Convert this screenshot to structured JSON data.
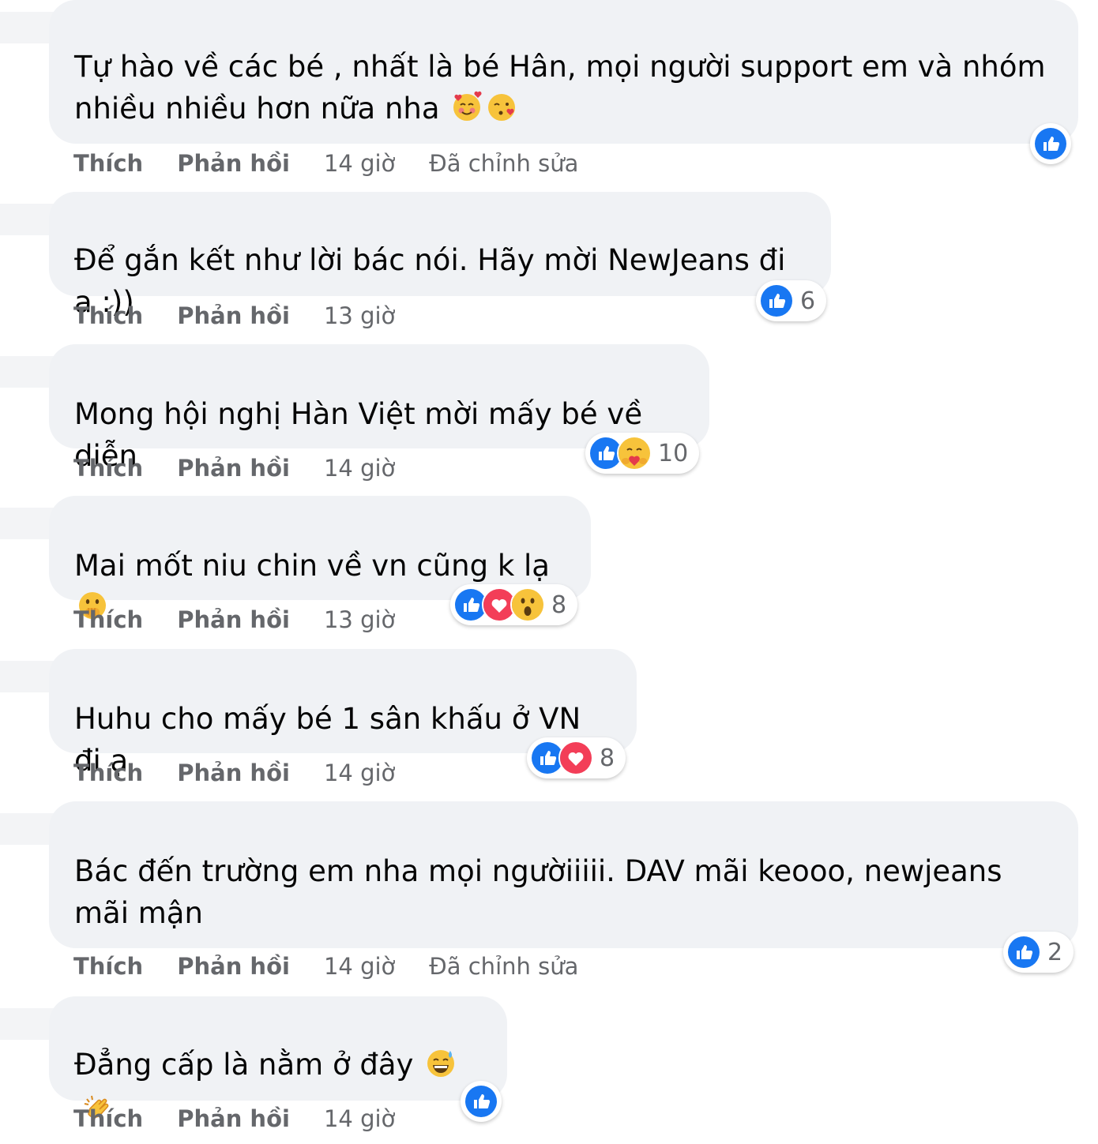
{
  "action_labels": {
    "like": "Thích",
    "reply": "Phản hồi"
  },
  "comments": [
    {
      "text": "Tự hào về các bé , nhất là bé Hân, mọi người support em và nhóm nhiều nhiều hơn nữa nha",
      "text_emojis": [
        "smiling-face-with-hearts",
        "face-blowing-kiss"
      ],
      "time": "14 giờ",
      "edited": "Đã chỉnh sửa",
      "reactions": [
        "like"
      ],
      "reaction_count": ""
    },
    {
      "text": "Để gắn kết như lời bác nói. Hãy mời NewJeans đi ạ :))",
      "text_emojis": [],
      "time": "13 giờ",
      "edited": "",
      "reactions": [
        "like"
      ],
      "reaction_count": "6"
    },
    {
      "text": "Mong hội nghị Hàn Việt mời mấy bé về diễn",
      "text_emojis": [],
      "time": "14 giờ",
      "edited": "",
      "reactions": [
        "like",
        "care"
      ],
      "reaction_count": "10"
    },
    {
      "text": "Mai mốt niu chin về vn cũng k lạ",
      "text_emojis": [
        "face-with-hand-over-mouth"
      ],
      "time": "13 giờ",
      "edited": "",
      "reactions": [
        "like",
        "love",
        "wow"
      ],
      "reaction_count": "8"
    },
    {
      "text": "Huhu cho mấy bé 1 sân khấu ở VN đi ạ",
      "text_emojis": [],
      "time": "14 giờ",
      "edited": "",
      "reactions": [
        "like",
        "love"
      ],
      "reaction_count": "8"
    },
    {
      "text": "Bác đến trường em nha mọi ngườiiiii. DAV mãi keooo, newjeans mãi mận",
      "text_emojis": [],
      "time": "14 giờ",
      "edited": "Đã chỉnh sửa",
      "reactions": [
        "like"
      ],
      "reaction_count": "2"
    },
    {
      "text": "Đẳng cấp là nằm ở đây",
      "text_emojis": [
        "grinning-sweat-face",
        "clapping-hands"
      ],
      "time": "14 giờ",
      "edited": "",
      "reactions": [
        "like"
      ],
      "reaction_count": ""
    }
  ],
  "colors": {
    "bubble_bg": "#f0f2f5",
    "like_blue": "#1877f2",
    "love_red": "#f33e58",
    "meta_gray": "#65676b"
  }
}
